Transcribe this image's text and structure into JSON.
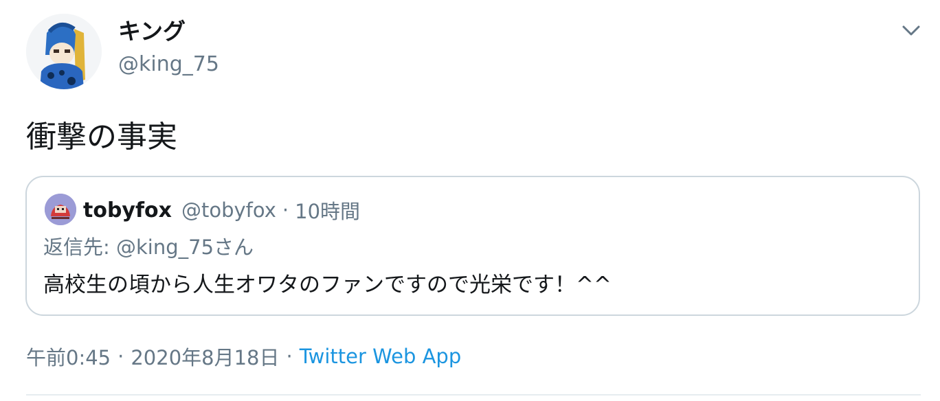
{
  "tweet": {
    "display_name": "キング",
    "username": "@king_75",
    "text": "衝撃の事実",
    "timestamp": "午前0:45",
    "date": "2020年8月18日",
    "separator": "·",
    "source": "Twitter Web App"
  },
  "quote": {
    "name": "tobyfox",
    "handle": "@tobyfox",
    "separator": "·",
    "time": "10時間",
    "reply_to": "返信先: @king_75さん",
    "text": "高校生の頃から人生オワタのファンですので光栄です！^^"
  },
  "icons": {
    "menu": "chevron-down-icon",
    "avatar": "anime-character-avatar",
    "quote_avatar": "tobyfox-avatar"
  },
  "colors": {
    "primary_text": "#14171a",
    "secondary_text": "#657786",
    "link": "#1b95e0",
    "border": "#ccd6dd"
  }
}
